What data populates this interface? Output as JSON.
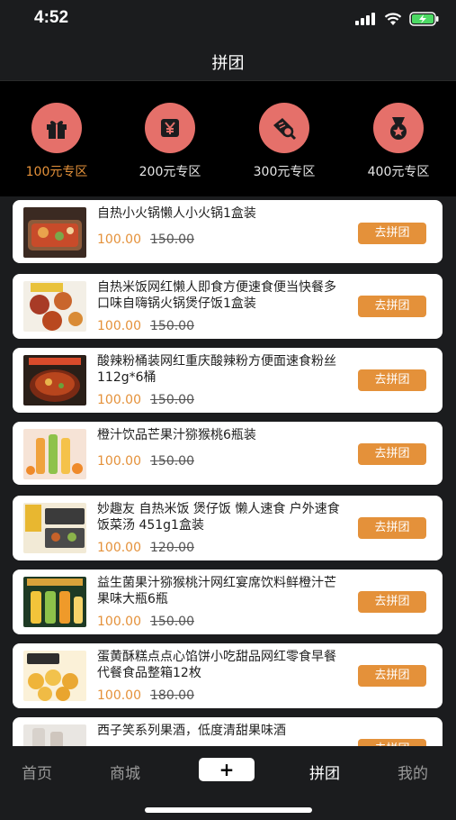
{
  "status": {
    "time": "4:52"
  },
  "header": {
    "title": "拼团"
  },
  "categories": [
    {
      "label": "100元专区",
      "icon": "gift-icon",
      "active": true
    },
    {
      "label": "200元专区",
      "icon": "yen-card-icon",
      "active": false
    },
    {
      "label": "300元专区",
      "icon": "ticket-search-icon",
      "active": false
    },
    {
      "label": "400元专区",
      "icon": "medal-icon",
      "active": false
    }
  ],
  "products": [
    {
      "title": "自热小火锅懒人小火锅1盒装",
      "price": "100.00",
      "old_price": "150.00",
      "button": "去拼团",
      "image": "hotpot-tray"
    },
    {
      "title": "自热米饭网红懒人即食方便速食便当快餐多口味自嗨锅火锅煲仔饭1盒装",
      "price": "100.00",
      "old_price": "150.00",
      "button": "去拼团",
      "image": "rice-bowls"
    },
    {
      "title": "酸辣粉桶装网红重庆酸辣粉方便面速食粉丝112g*6桶",
      "price": "100.00",
      "old_price": "150.00",
      "button": "去拼团",
      "image": "noodle-bowl"
    },
    {
      "title": "橙汁饮品芒果汁猕猴桃6瓶装",
      "price": "100.00",
      "old_price": "150.00",
      "button": "去拼团",
      "image": "juice-bottles"
    },
    {
      "title": "妙趣友 自热米饭 煲仔饭 懒人速食 户外速食 饭菜汤 451g1盒装",
      "price": "100.00",
      "old_price": "120.00",
      "button": "去拼团",
      "image": "meal-boxes"
    },
    {
      "title": "益生菌果汁猕猴桃汁网红宴席饮料鲜橙汁芒果味大瓶6瓶",
      "price": "100.00",
      "old_price": "150.00",
      "button": "去拼团",
      "image": "juice-jugs"
    },
    {
      "title": "蛋黄酥糕点点心馅饼小吃甜品网红零食早餐代餐食品整箱12枚",
      "price": "100.00",
      "old_price": "180.00",
      "button": "去拼团",
      "image": "egg-yolk-pastry"
    },
    {
      "title": "西子笑系列果酒，低度清甜果味酒",
      "price": "",
      "old_price": "",
      "button": "去拼团",
      "image": "fruit-wine"
    }
  ],
  "tabbar": {
    "home": "首页",
    "mall": "商城",
    "plus": "+",
    "group": "拼团",
    "mine": "我的"
  },
  "colors": {
    "accent": "#e4913a",
    "category_circle": "#e5706a",
    "background": "#1b1c1e"
  }
}
